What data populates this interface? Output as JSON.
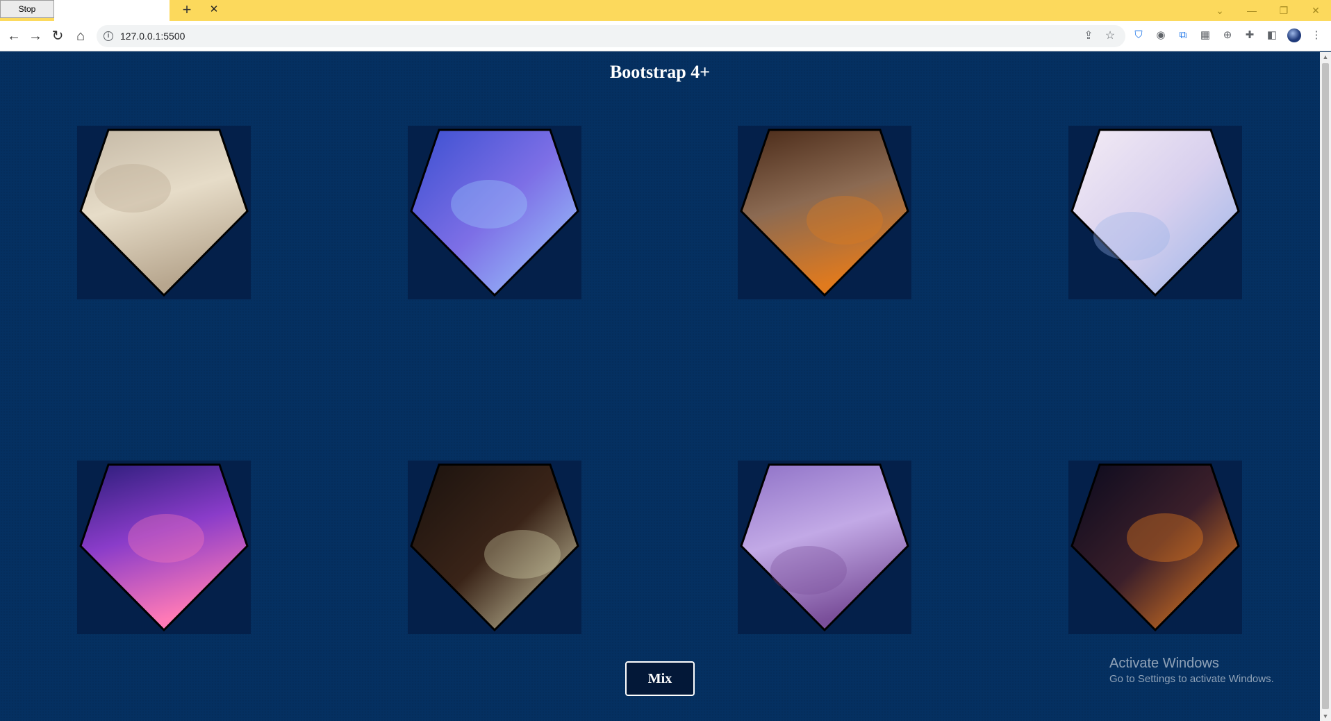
{
  "browser": {
    "tab_title": "Stop",
    "tab_close": "✕",
    "new_tab": "+",
    "url": "127.0.0.1:5500",
    "window_controls": {
      "chevron": "⌄",
      "minimize": "—",
      "restore": "❐",
      "close": "✕"
    }
  },
  "page": {
    "title": "Bootstrap 4+",
    "mix_button": "Mix",
    "background_color": "#053061",
    "cards": [
      {
        "image": "cloudy-planet-surface",
        "colors": [
          "#c5b9a6",
          "#e6dcc8",
          "#b7a68e"
        ]
      },
      {
        "image": "blue-nebula",
        "colors": [
          "#3a4fd0",
          "#7d6fe6",
          "#9fd1ff"
        ]
      },
      {
        "image": "fiery-planet",
        "colors": [
          "#4a2a18",
          "#8b6a52",
          "#e07a1e"
        ]
      },
      {
        "image": "pastel-sky",
        "colors": [
          "#f4ecf5",
          "#d8d0ee",
          "#98b3e8"
        ]
      },
      {
        "image": "pink-galaxy",
        "colors": [
          "#2b1d7a",
          "#8a3cc9",
          "#ff7ab6"
        ]
      },
      {
        "image": "dark-space-planet",
        "colors": [
          "#1a120e",
          "#3a2418",
          "#d9d6b0"
        ]
      },
      {
        "image": "purple-landscape",
        "colors": [
          "#8f72c7",
          "#c2a9e6",
          "#7a4f9a"
        ]
      },
      {
        "image": "space-sunset",
        "colors": [
          "#0a0a1e",
          "#3b1f2a",
          "#ff8a1e"
        ]
      }
    ]
  },
  "windows_watermark": {
    "title": "Activate Windows",
    "subtitle": "Go to Settings to activate Windows."
  }
}
